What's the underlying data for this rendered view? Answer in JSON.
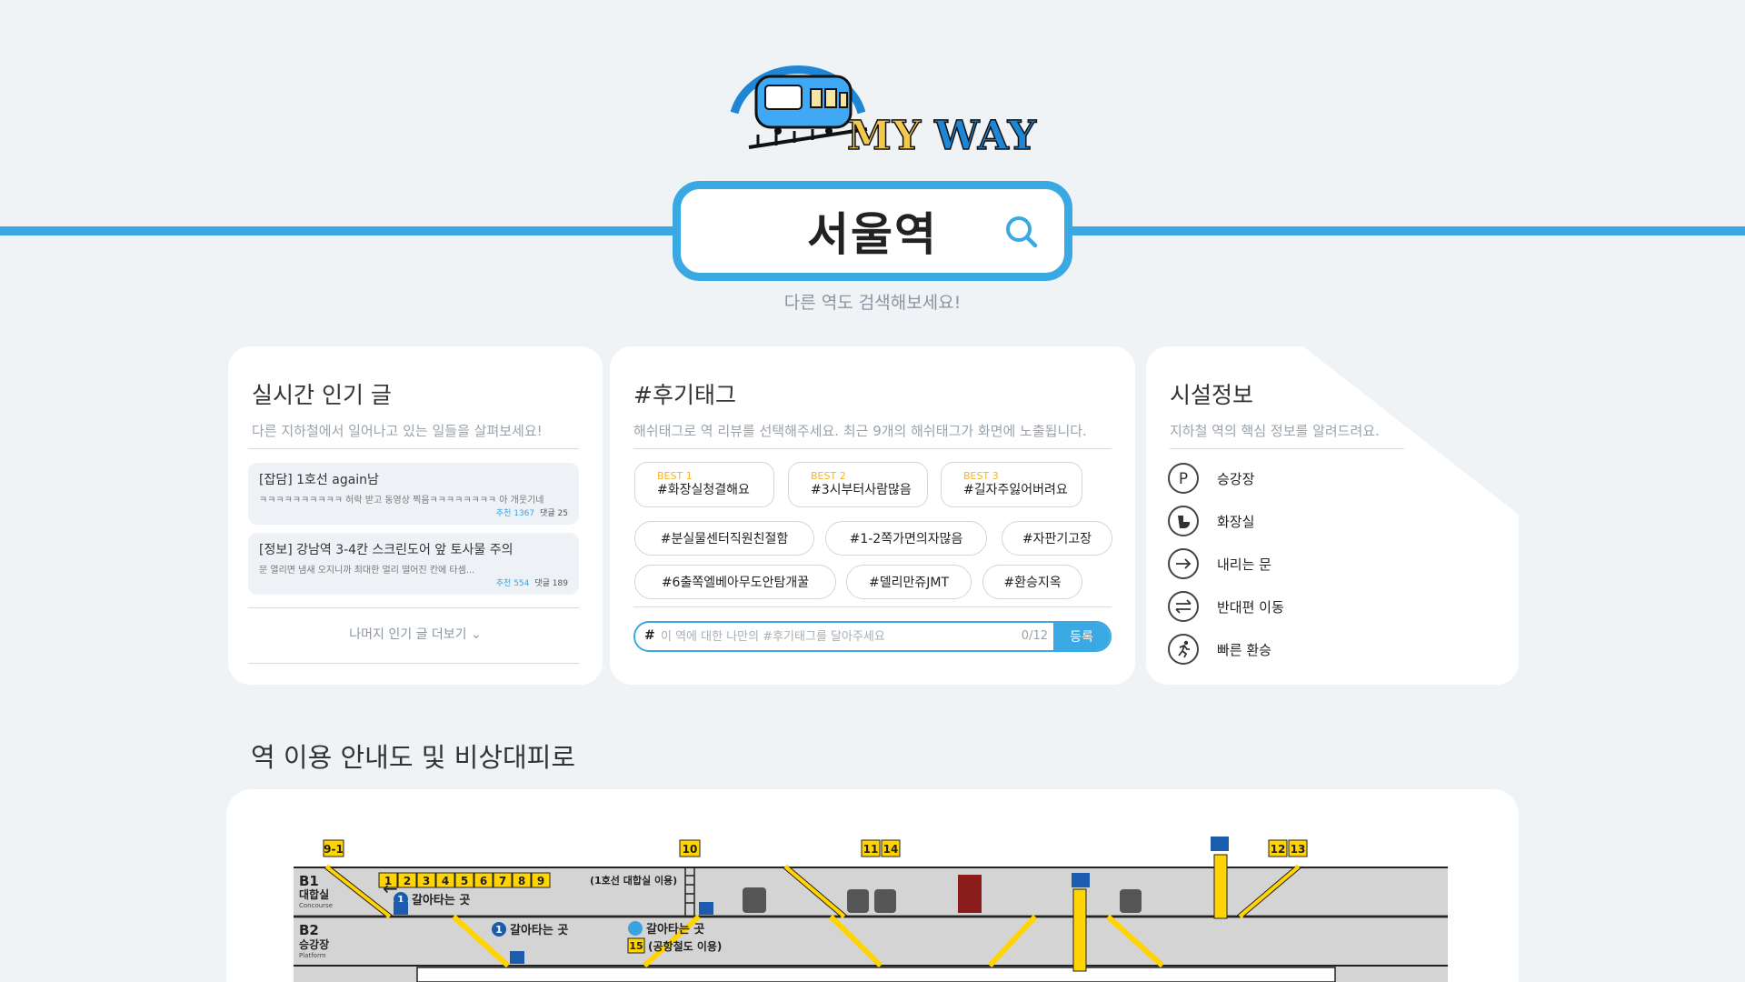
{
  "logo": {
    "text_my": "MY",
    "text_way": "WAY"
  },
  "search": {
    "value": "서울역",
    "hint": "다른 역도 검색해보세요!"
  },
  "popular": {
    "title": "실시간 인기 글",
    "subtitle": "다른 지하철에서 일어나고 있는 일들을 살펴보세요!",
    "posts": [
      {
        "title": "[잡담] 1호선 again남",
        "body": "ㅋㅋㅋㅋㅋㅋㅋㅋㅋㅋ 허락 받고 동영상 찍음ㅋㅋㅋㅋㅋㅋㅋㅋ 아 개웃기네",
        "rec": "추천 1367",
        "comments": "댓글 25"
      },
      {
        "title": "[정보] 강남역 3-4칸 스크린도어 앞 토사물 주의",
        "body": "문 열리면 냄새 오지니까 최대한 멀리 떨어진 칸에 타셈...",
        "rec": "추천 554",
        "comments": "댓글 189"
      }
    ],
    "more": "나머지 인기 글 더보기 ⌄"
  },
  "tags": {
    "title": "#후기태그",
    "subtitle": "해쉬태그로 역 리뷰를 선택해주세요. 최근 9개의 해쉬태그가 화면에 노출됩니다.",
    "best": [
      {
        "label": "BEST 1",
        "name": "#화장실청결해요"
      },
      {
        "label": "BEST 2",
        "name": "#3시부터사람많음"
      },
      {
        "label": "BEST 3",
        "name": "#길자주잃어버려요"
      }
    ],
    "others": [
      "#분실물센터직원친절함",
      "#1-2쪽가면의자많음",
      "#자판기고장",
      "#6출쪽엘베아무도안탐개꿀",
      "#델리만쥬JMT",
      "#환승지옥"
    ],
    "input_hash": "#",
    "input_placeholder": "이 역에 대한 나만의 #후기태그를 달아주세요",
    "counter": "0/12",
    "submit": "등록"
  },
  "facilities": {
    "title": "시설정보",
    "subtitle": "지하철 역의 핵심 정보를 알려드려요.",
    "items": [
      {
        "icon": "parking-icon",
        "label": "승강장"
      },
      {
        "icon": "toilet-icon",
        "label": "화장실"
      },
      {
        "icon": "exit-arrow-icon",
        "label": "내리는 문"
      },
      {
        "icon": "swap-arrows-icon",
        "label": "반대편 이동"
      },
      {
        "icon": "running-person-icon",
        "label": "빠른 환승"
      }
    ]
  },
  "map": {
    "title": "역 이용 안내도 및 비상대피로",
    "levels": [
      {
        "code": "B1",
        "name": "대합실",
        "en": "Concourse"
      },
      {
        "code": "B2",
        "name": "승강장",
        "en": "Platform"
      }
    ],
    "exits": [
      "9-1",
      "10",
      "11",
      "14",
      "12",
      "13"
    ],
    "gates": [
      "1",
      "2",
      "3",
      "4",
      "5",
      "6",
      "7",
      "8",
      "9"
    ],
    "notes": {
      "gate_note": "(1호선 대합실 이용)",
      "transfer_b1": "갈아타는 곳",
      "transfer_b2a": "갈아타는 곳",
      "transfer_b2b": "갈아타는 곳",
      "airport": "(공항철도 이용)",
      "line1": "1",
      "exit15": "15"
    },
    "colors": {
      "signage": "#ffd400",
      "floor": "#d4d4d4",
      "line1": "#1b5cae"
    }
  }
}
